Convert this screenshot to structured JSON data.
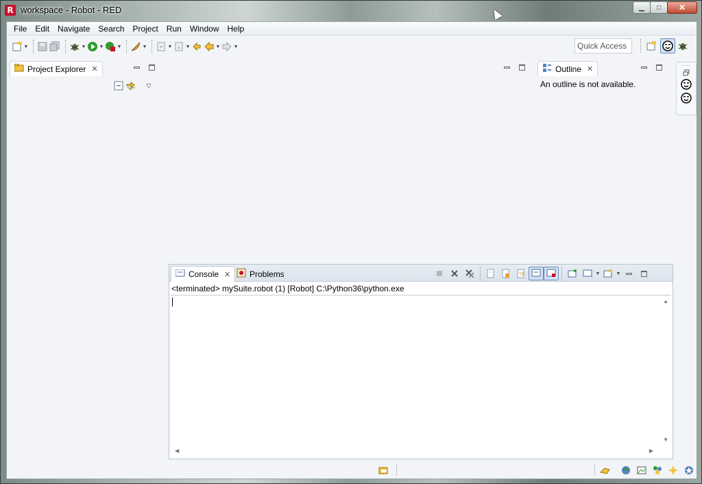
{
  "window": {
    "logo": "R",
    "title": "workspace - Robot - RED",
    "minimize_label": "▁",
    "maximize_label": "□",
    "close_label": "✕"
  },
  "menu": [
    "File",
    "Edit",
    "Navigate",
    "Search",
    "Project",
    "Run",
    "Window",
    "Help"
  ],
  "toolbar": {
    "quick_access": "Quick Access",
    "icons": [
      "new-icon",
      "save-icon",
      "save-all-icon",
      "debug-icon",
      "run-icon",
      "external-tools-icon",
      "open-type-icon",
      "next-annotation-icon",
      "prev-annotation-icon",
      "last-edit-icon",
      "back-icon",
      "forward-icon"
    ],
    "perspectives": [
      "open-perspective-icon",
      "robot-perspective-icon",
      "debug-perspective-icon"
    ]
  },
  "project_explorer": {
    "tab_label": "Project Explorer"
  },
  "outline": {
    "tab_label": "Outline",
    "message": "An outline is not available."
  },
  "console": {
    "tabs": [
      {
        "label": "Console",
        "active": true
      },
      {
        "label": "Problems",
        "active": false
      }
    ],
    "description": "<terminated> mySuite.robot (1) [Robot] C:\\Python36\\python.exe",
    "output": ""
  },
  "colors": {
    "accent": "#c8102e",
    "panel_bg": "#f2f4f7",
    "run_green": "#2e9b2e"
  }
}
